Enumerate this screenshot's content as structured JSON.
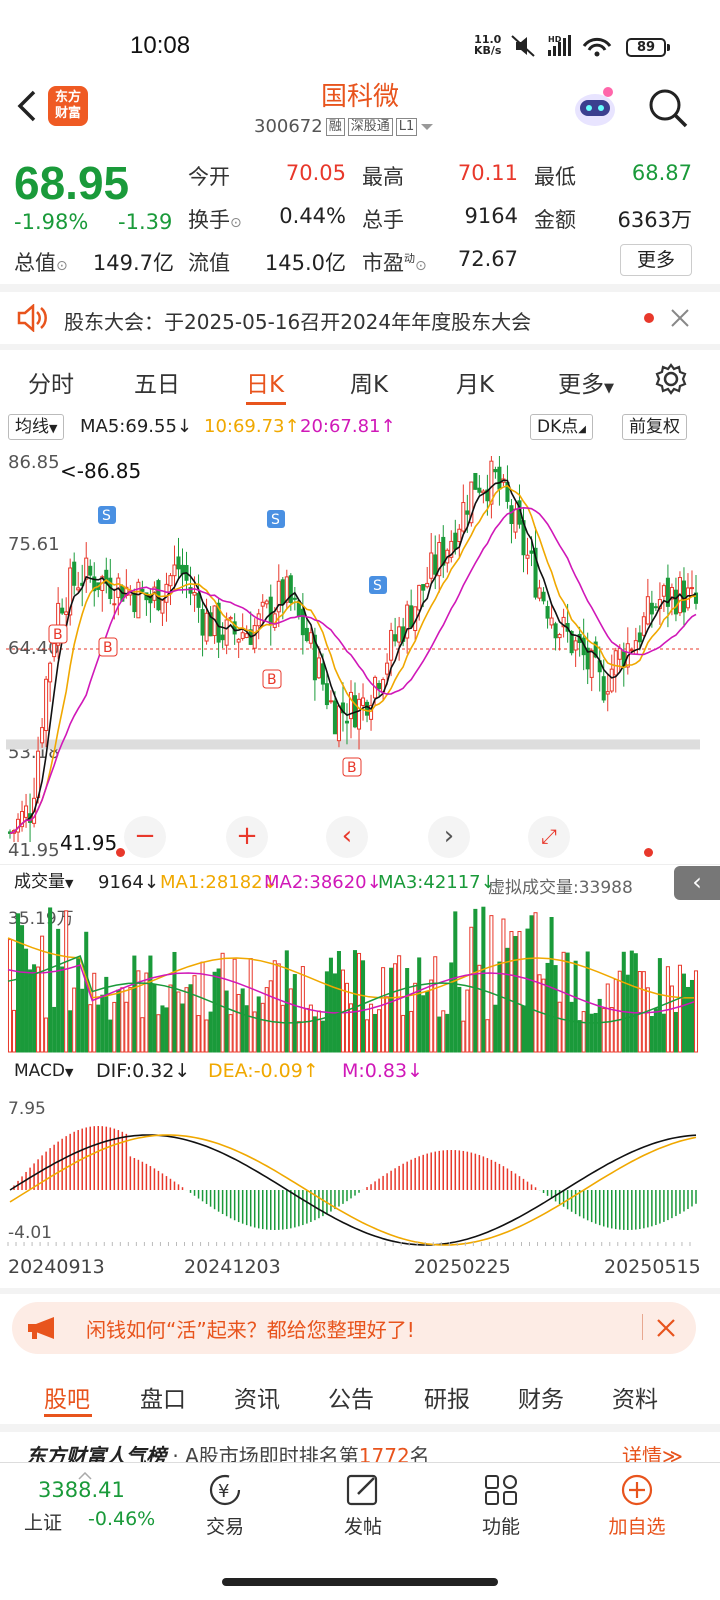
{
  "status_bar": {
    "time": "10:08",
    "net_speed_value": "11.0",
    "net_speed_unit": "KB/s",
    "battery": "89"
  },
  "header": {
    "logo_text_1": "东方",
    "logo_text_2": "财富",
    "title": "国科微",
    "code": "300672",
    "tag_rong": "融",
    "tag_sgt": "深股通",
    "tag_l1": "L1"
  },
  "quote": {
    "price": "68.95",
    "change_pct": "-1.98%",
    "change": "-1.39",
    "open_label": "今开",
    "open": "70.05",
    "high_label": "最高",
    "high": "70.11",
    "low_label": "最低",
    "low": "68.87",
    "turnover_label": "换手",
    "turnover": "0.44%",
    "volume_label": "总手",
    "volume": "9164",
    "amount_label": "金额",
    "amount": "6363万",
    "mcap_label": "总值",
    "mcap": "149.7亿",
    "float_label": "流值",
    "float": "145.0亿",
    "pe_label": "市盈",
    "pe_sup": "动",
    "pe": "72.67",
    "more": "更多"
  },
  "notice": {
    "text": "股东大会：于2025-05-16召开2024年年度股东大会"
  },
  "period_tabs": [
    "分时",
    "五日",
    "日K",
    "周K",
    "月K",
    "更多"
  ],
  "active_period": "日K",
  "ma_legend": {
    "selector": "均线",
    "ma5": "MA5:69.55",
    "ma10": "10:69.73",
    "ma20": "20:67.81",
    "dk": "DK点",
    "adj": "前复权"
  },
  "kline": {
    "y_labels": [
      "86.85",
      "75.61",
      "64.40",
      "53.18",
      "41.95"
    ],
    "max_label": "<-86.85",
    "min_label": "41.95",
    "signal_s": "S",
    "signal_b": "B"
  },
  "volume_legend": {
    "selector": "成交量",
    "vol": "9164",
    "ma1": "MA1:28182",
    "ma2": "MA2:38620",
    "ma3": "MA3:42117",
    "virtual": "虚拟成交量:33988",
    "y_max": "35.19万"
  },
  "macd_legend": {
    "selector": "MACD",
    "dif": "DIF:0.32",
    "dea": "DEA:-0.09",
    "m": "M:0.83",
    "y_max": "7.95",
    "y_min": "-4.01"
  },
  "x_dates": [
    "20240913",
    "20241203",
    "20250225",
    "20250515"
  ],
  "promo": {
    "text": "闲钱如何“活”起来？都给您整理好了!"
  },
  "bottom_tabs": [
    "股吧",
    "盘口",
    "资讯",
    "公告",
    "研报",
    "财务",
    "资料"
  ],
  "ranking": {
    "brand": "东方财富人气榜",
    "text_prefix": "· A股市场即时排名第",
    "rank": "1772",
    "text_suffix": "名",
    "detail": "详情"
  },
  "index": {
    "value": "3388.41",
    "name": "上证",
    "change": "-0.46%"
  },
  "nav": [
    "交易",
    "发帖",
    "功能",
    "加自选"
  ],
  "colors": {
    "accent": "#e8541d",
    "up": "#e8382b",
    "down": "#1a9a3a"
  }
}
